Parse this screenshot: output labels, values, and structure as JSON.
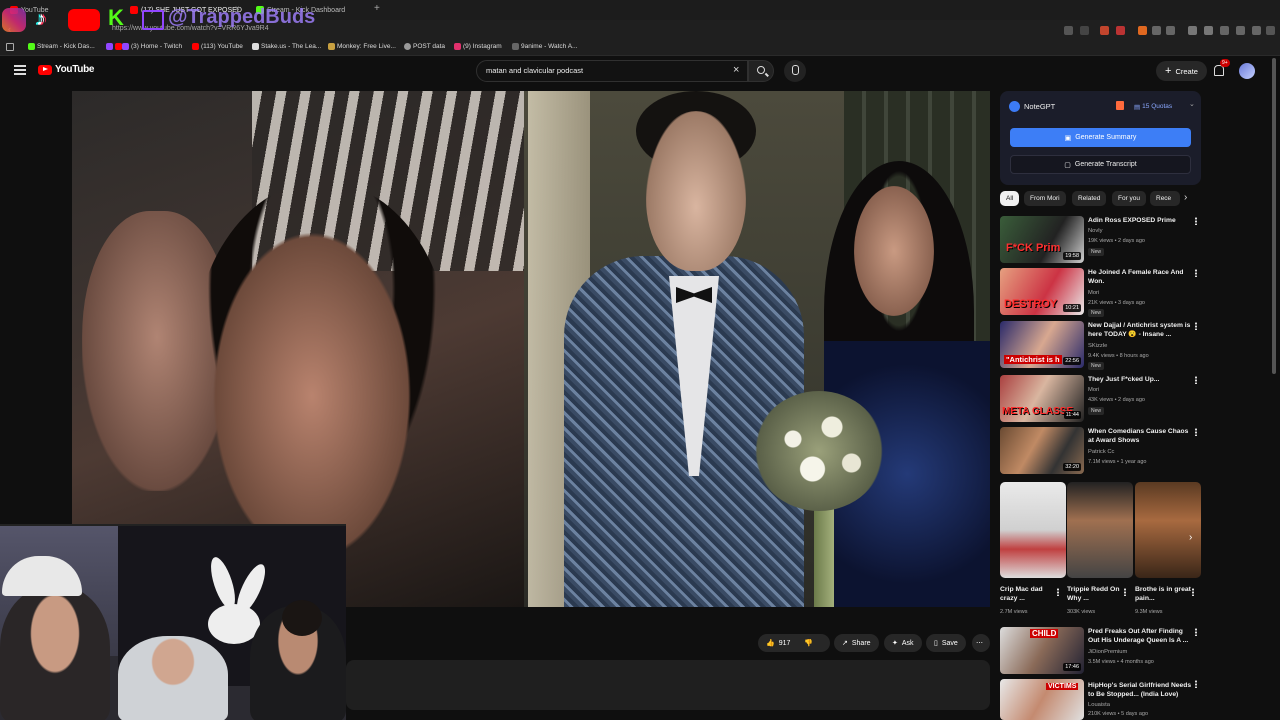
{
  "browser": {
    "tabs": [
      {
        "label": "YouTube",
        "active": false
      },
      {
        "label": "(17) SHE JUST GOT EXPOSED",
        "active": true
      },
      {
        "label": "Stream - Kick Dashboard",
        "active": false
      }
    ],
    "url": "https://www.youtube.com/watch?v=VRR6YJva9R4",
    "bookmarks": [
      {
        "label": "Stream - Kick Das..."
      },
      {
        "label": "(3) Home - Twitch"
      },
      {
        "label": "(113) YouTube"
      },
      {
        "label": "Stake.us - The Lea..."
      },
      {
        "label": "Monkey: Free Live..."
      },
      {
        "label": "POST data"
      },
      {
        "label": "(9) Instagram"
      },
      {
        "label": "9anime - Watch A..."
      }
    ],
    "overlay_handle": "@TrappedBuds"
  },
  "youtube": {
    "logo_text": "YouTube",
    "search_query": "matan and clavicular podcast",
    "create_label": "Create",
    "notification_badge": "9+"
  },
  "actions": {
    "likes": "917",
    "share_label": "Share",
    "ask_label": "Ask",
    "save_label": "Save"
  },
  "notegpt": {
    "title": "NoteGPT",
    "quota": "15 Quotas",
    "summary_label": "Generate Summary",
    "transcript_label": "Generate Transcript"
  },
  "chips": [
    "All",
    "From Mori",
    "Related",
    "For you",
    "Rece"
  ],
  "recommendations": [
    {
      "title": "Adin Ross EXPOSED Prime",
      "channel": "Novly",
      "meta": "19K views • 2 days ago",
      "duration": "19:58",
      "badge": "New",
      "thumb_text": "F*CK Prim"
    },
    {
      "title": "He Joined A Female Race And Won.",
      "channel": "Mori",
      "meta": "21K views • 3 days ago",
      "duration": "10:21",
      "badge": "New",
      "thumb_text": "DESTROY"
    },
    {
      "title": "New Dajjal / Antichrist system is here TODAY 😮 - Insane ...",
      "channel": "SKizzle",
      "meta": "9.4K views • 8 hours ago",
      "duration": "22:56",
      "badge": "New",
      "thumb_text": "\"Antichrist is h"
    },
    {
      "title": "They Just F*cked Up...",
      "channel": "Mori",
      "meta": "43K views • 2 days ago",
      "duration": "11:44",
      "badge": "New",
      "thumb_text": "META GLASSE"
    },
    {
      "title": "When Comedians Cause Chaos at Award Shows",
      "channel": "Patrick Cc",
      "meta": "7.1M views • 1 year ago",
      "duration": "32:20",
      "badge": "",
      "thumb_text": ""
    }
  ],
  "shorts": [
    {
      "title": "Crip Mac dad crazy ...",
      "views": "2.7M views"
    },
    {
      "title": "Trippie Redd On Why ...",
      "views": "303K views"
    },
    {
      "title": "Brothe is in great pain...",
      "views": "9.3M views"
    }
  ],
  "recommendations2": [
    {
      "title": "Pred Freaks Out After Finding Out His Underage Queen Is A ...",
      "channel": "JiDionPremium",
      "meta": "3.5M views • 4 months ago",
      "duration": "17:46",
      "thumb_text": "CHILD"
    },
    {
      "title": "HipHop's Serial Girlfriend Needs to Be Stopped... (India Love)",
      "channel": "Louaista",
      "meta": "210K views • 5 days ago",
      "duration": "",
      "thumb_text": "VICTIMS"
    }
  ],
  "colors": {
    "accent": "#ff0000",
    "notegpt_blue": "#3d7ef6",
    "background": "#0f0f0f"
  }
}
